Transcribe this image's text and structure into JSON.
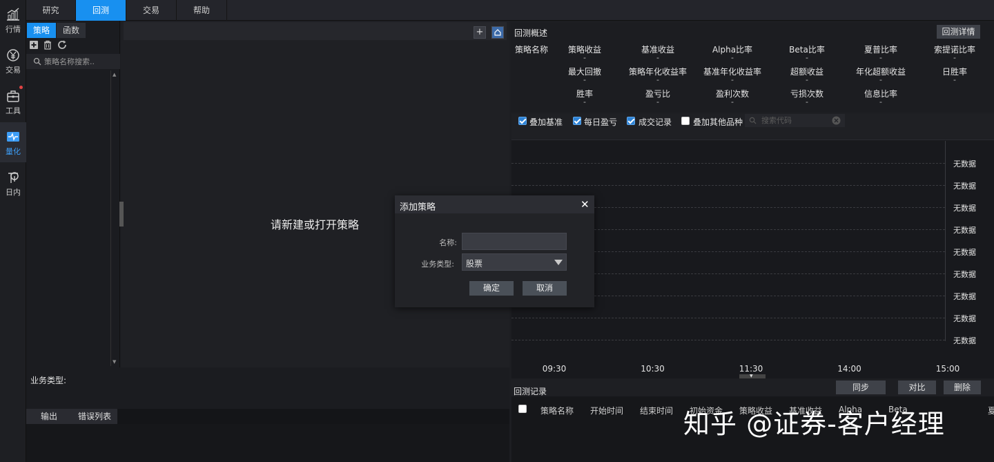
{
  "rail": {
    "items": [
      {
        "label": "行情",
        "icon": "chart-icon"
      },
      {
        "label": "交易",
        "icon": "yen-icon"
      },
      {
        "label": "工具",
        "icon": "toolbox-icon"
      },
      {
        "label": "量化",
        "icon": "pulse-icon"
      },
      {
        "label": "日内",
        "icon": "intraday-icon"
      }
    ],
    "active": "量化"
  },
  "top_tabs": [
    "研究",
    "回测",
    "交易",
    "帮助"
  ],
  "top_active": "回测",
  "left_panel": {
    "tabs": [
      "策略",
      "函数"
    ],
    "search_placeholder": "策略名称搜索.."
  },
  "editor": {
    "add_btn": "+",
    "placeholder_message": "请新建或打开策略"
  },
  "biz_panel": {
    "label": "业务类型:"
  },
  "output_tabs": [
    "输出",
    "错误列表"
  ],
  "overview": {
    "title": "回测概述",
    "detail_button": "回测详情",
    "strategy_name_label": "策略名称",
    "metrics": [
      [
        "策略收益",
        "基准收益",
        "Alpha比率",
        "Beta比率",
        "夏普比率",
        "索提诺比率"
      ],
      [
        "最大回撤",
        "策略年化收益率",
        "基准年化收益率",
        "超额收益",
        "年化超额收益",
        "日胜率"
      ],
      [
        "胜率",
        "盈亏比",
        "盈利次数",
        "亏损次数",
        "信息比率"
      ]
    ],
    "empty_value": "-"
  },
  "options": {
    "checkboxes": [
      {
        "label": "叠加基准",
        "checked": true
      },
      {
        "label": "每日盈亏",
        "checked": true
      },
      {
        "label": "成交记录",
        "checked": true
      },
      {
        "label": "叠加其他品种",
        "checked": false
      }
    ],
    "search_placeholder": "搜索代码"
  },
  "chart_data": {
    "type": "line",
    "x_ticks": [
      "09:30",
      "10:30",
      "11:30",
      "14:00",
      "15:00"
    ],
    "empty_label": "无数据",
    "series": [],
    "grid": true
  },
  "records": {
    "title": "回测记录",
    "buttons": [
      "同步",
      "对比",
      "删除"
    ],
    "columns": [
      "策略名称",
      "开始时间",
      "结束时间",
      "初始资金",
      "策略收益",
      "基准收益",
      "Alpha",
      "Beta",
      "夏"
    ]
  },
  "dialog": {
    "title": "添加策略",
    "name_label": "名称:",
    "name_value": "",
    "type_label": "业务类型:",
    "type_value": "股票",
    "ok": "确定",
    "cancel": "取消"
  },
  "watermark": "知乎 @证券-客户经理",
  "colors": {
    "accent": "#1890f0",
    "background": "#1d1e22",
    "panel": "#1c1d21"
  }
}
